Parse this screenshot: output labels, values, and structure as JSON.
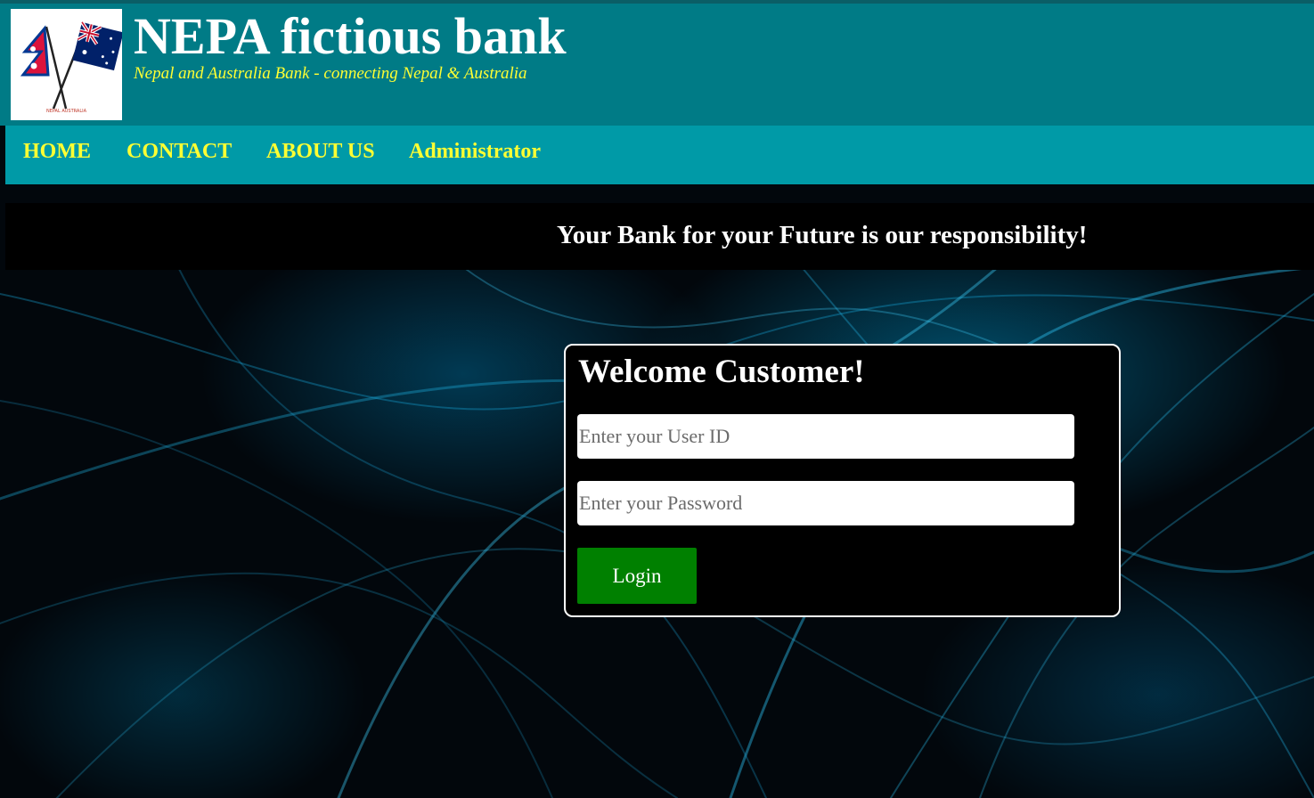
{
  "header": {
    "title": "NEPA fictious bank",
    "tagline": "Nepal and Australia Bank - connecting Nepal & Australia",
    "logo_caption": "NEPAL AUSTRALIA"
  },
  "nav": {
    "items": [
      {
        "label": "HOME"
      },
      {
        "label": "CONTACT"
      },
      {
        "label": "ABOUT US"
      },
      {
        "label": "Administrator"
      }
    ]
  },
  "banner": {
    "text": "Your Bank for your Future is our responsibility!"
  },
  "login": {
    "title": "Welcome Customer!",
    "user_placeholder": "Enter your User ID",
    "password_placeholder": "Enter your Password",
    "button_label": "Login"
  },
  "colors": {
    "header_bg": "#007b86",
    "nav_bg": "#009aa7",
    "nav_text": "#ffff33",
    "tagline": "#ffff33",
    "button_bg": "#008000"
  },
  "icons": {
    "logo": "nepal-australia-flags-icon"
  }
}
